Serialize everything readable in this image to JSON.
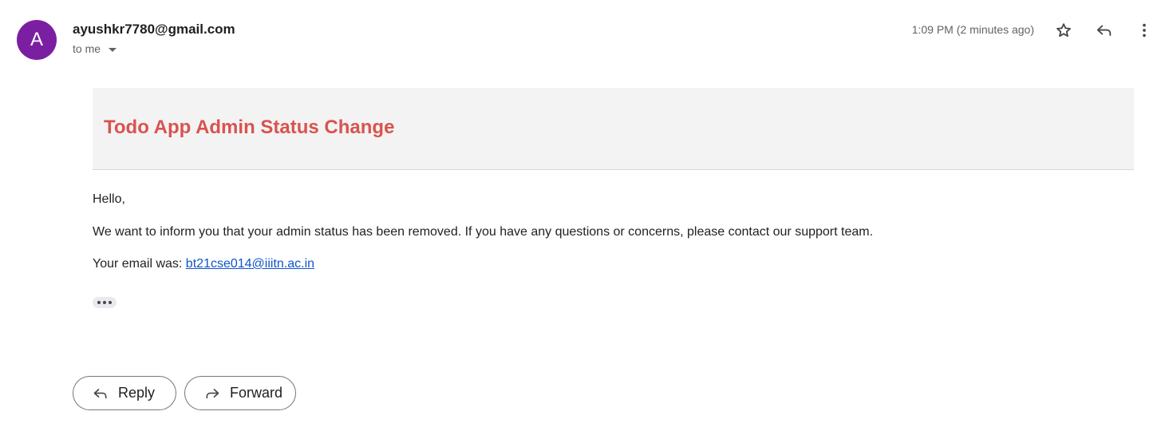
{
  "sender": {
    "avatar_letter": "A",
    "avatar_color": "#7b1fa2",
    "email": "ayushkr7780@gmail.com",
    "recipient_label": "to me"
  },
  "header": {
    "timestamp": "1:09 PM (2 minutes ago)",
    "icons": [
      "star-icon",
      "reply-icon",
      "more-vert-icon"
    ]
  },
  "email": {
    "banner_title": "Todo App Admin Status Change",
    "banner_title_color": "#d9534f",
    "greeting": "Hello,",
    "message": "We want to inform you that your admin status has been removed. If you have any questions or concerns, please contact our support team.",
    "email_prefix": "Your email was: ",
    "email_address": "bt21cse014@iiitn.ac.in"
  },
  "actions": {
    "reply_label": "Reply",
    "forward_label": "Forward"
  }
}
